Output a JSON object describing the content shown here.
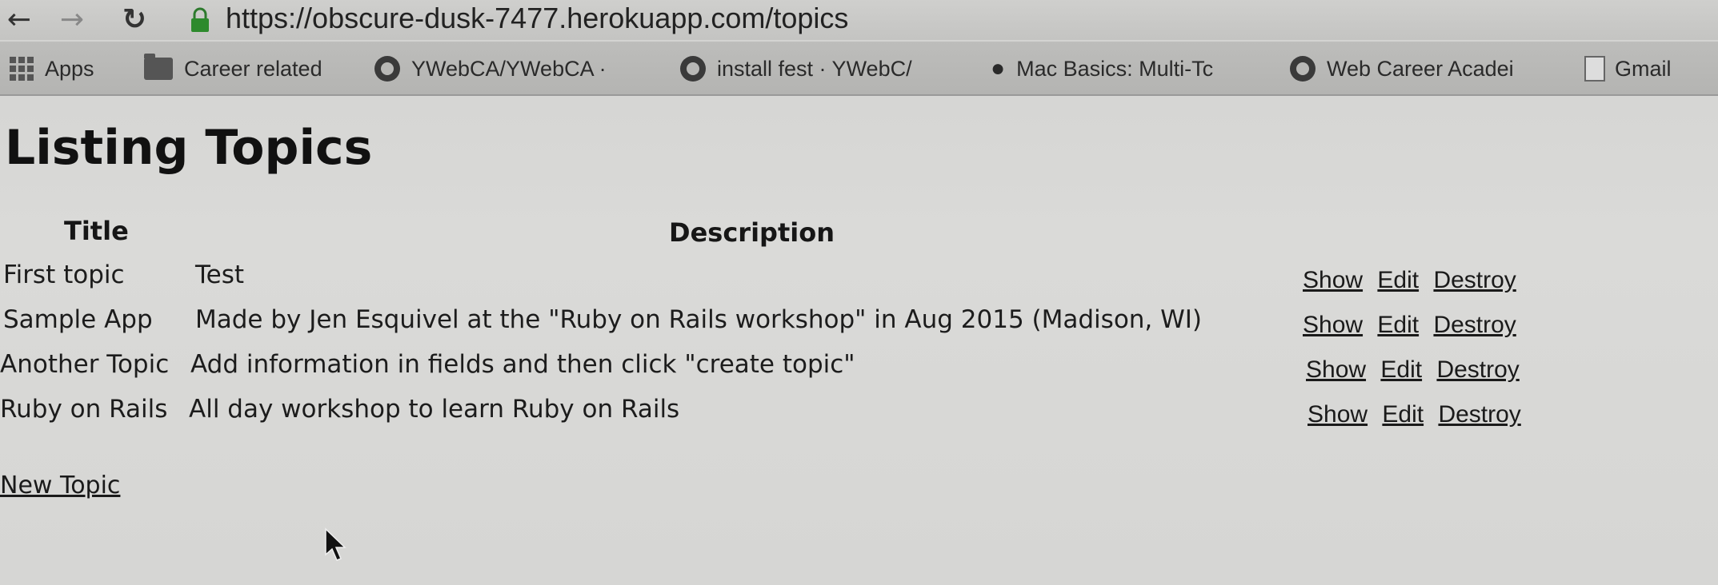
{
  "browser": {
    "url": "https://obscure-dusk-7477.herokuapp.com/topics",
    "nav_icons": [
      "back-arrow-icon",
      "forward-arrow-icon",
      "reload-icon"
    ],
    "bookmarks": [
      {
        "label": "Apps",
        "icon": "apps-grid-icon"
      },
      {
        "label": "Career related",
        "icon": "folder-icon"
      },
      {
        "label": "YWebCA/YWebCA ·",
        "icon": "github-icon"
      },
      {
        "label": "install fest · YWebC/",
        "icon": "github-icon"
      },
      {
        "label": "Mac Basics: Multi-Tc",
        "icon": "apple-icon"
      },
      {
        "label": "Web Career Acadei",
        "icon": "github-icon"
      },
      {
        "label": "Gmail",
        "icon": "document-icon"
      }
    ]
  },
  "page": {
    "title": "Listing Topics",
    "columns": {
      "title": "Title",
      "description": "Description"
    },
    "topics": [
      {
        "title": "First topic",
        "description": "Test"
      },
      {
        "title": "Sample App",
        "description": "Made by Jen Esquivel at the \"Ruby on Rails workshop\" in Aug 2015 (Madison, WI)"
      },
      {
        "title": "Another Topic",
        "description": "Add information in fields and then click \"create topic\""
      },
      {
        "title": "Ruby on Rails",
        "description": "All day workshop to learn Ruby on Rails"
      }
    ],
    "actions": {
      "show": "Show",
      "edit": "Edit",
      "destroy": "Destroy"
    },
    "new_topic_link": "New Topic"
  }
}
